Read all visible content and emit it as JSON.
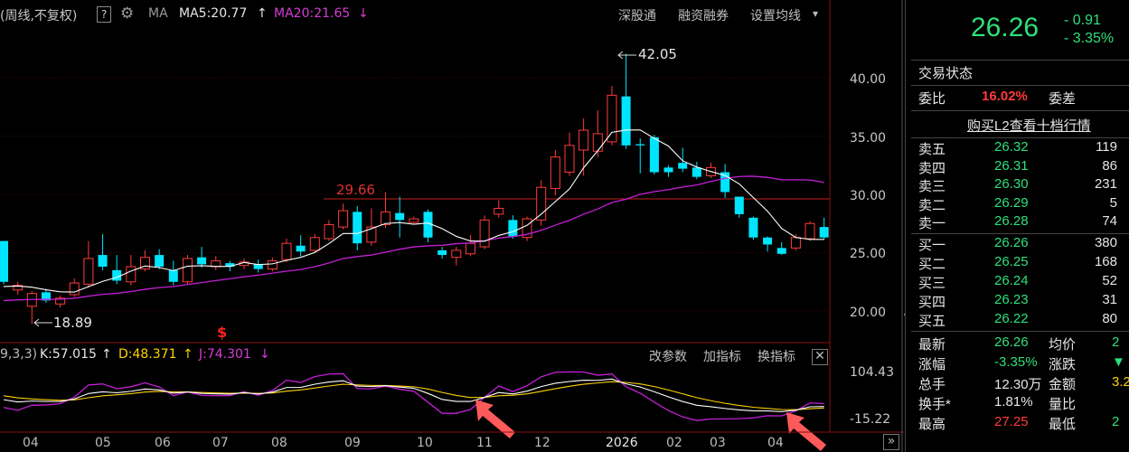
{
  "toolbar": {
    "period_label": "(周线,不复权)",
    "help_label": "?",
    "ma_label": "MA",
    "ma5_label": "MA5:20.77",
    "ma5_arrow": "↑",
    "ma20_label": "MA20:21.65",
    "ma20_arrow": "↓",
    "links": [
      "深股通",
      "融资融券",
      "设置均线"
    ],
    "dropdown_glyph": "▾"
  },
  "main_chart": {
    "y_ticks": [
      "40.00",
      "35.00",
      "30.00",
      "25.00",
      "20.00"
    ],
    "high_annotation": "42.05",
    "low_annotation": "18.89",
    "reference_line_label": "29.66",
    "marker_symbol": "$"
  },
  "kdj": {
    "params_label": "9,3,3)",
    "k_label": "K:57.015",
    "k_arrow": "↑",
    "d_label": "D:48.371",
    "d_arrow": "↑",
    "j_label": "J:74.301",
    "j_arrow": "↓",
    "buttons": [
      "改参数",
      "加指标",
      "换指标"
    ],
    "close_glyph": "✕",
    "y_top": "104.43",
    "y_bottom": "-15.22"
  },
  "x_axis": {
    "labels": [
      "04",
      "05",
      "06",
      "07",
      "08",
      "09",
      "10",
      "11",
      "12",
      "2026",
      "02",
      "03",
      "04"
    ],
    "scroll_glyph": "»"
  },
  "colors": {
    "up": "#ff3b3b",
    "down": "#00e5ff",
    "ma5": "#ffffff",
    "ma20": "#c31fd6",
    "k_line": "#ffffff",
    "d_line": "#ffd200",
    "j_line": "#c31fd6",
    "ref_line": "#c81e1e",
    "panel_green": "#2ee07a"
  },
  "chart_data": {
    "type": "candlestick",
    "period": "weekly",
    "series": [
      {
        "name": "MA5",
        "value": 20.77
      },
      {
        "name": "MA20",
        "value": 21.65
      }
    ],
    "high": 42.05,
    "low": 18.89,
    "reference": 29.66,
    "ylim": [
      17.5,
      45
    ],
    "candles": [
      [
        26.0,
        22.5,
        26.0,
        22.3
      ],
      [
        21.8,
        22.2,
        22.5,
        21.4
      ],
      [
        20.4,
        21.5,
        21.7,
        18.9
      ],
      [
        21.6,
        20.9,
        21.9,
        20.7
      ],
      [
        20.6,
        21.1,
        21.3,
        20.3
      ],
      [
        21.4,
        22.4,
        22.8,
        21.2
      ],
      [
        22.3,
        24.5,
        26.0,
        22.0
      ],
      [
        24.8,
        23.8,
        26.6,
        23.5
      ],
      [
        23.5,
        22.6,
        24.8,
        22.3
      ],
      [
        22.5,
        23.8,
        24.8,
        22.2
      ],
      [
        23.6,
        24.6,
        25.2,
        23.4
      ],
      [
        24.8,
        23.8,
        25.3,
        23.6
      ],
      [
        23.5,
        22.5,
        24.3,
        22.2
      ],
      [
        22.5,
        24.5,
        24.8,
        22.3
      ],
      [
        24.6,
        24.0,
        25.5,
        23.7
      ],
      [
        23.8,
        24.3,
        24.7,
        23.5
      ],
      [
        24.1,
        23.8,
        24.3,
        23.4
      ],
      [
        23.9,
        24.2,
        24.5,
        23.6
      ],
      [
        24.0,
        23.6,
        24.4,
        23.3
      ],
      [
        23.6,
        24.3,
        24.6,
        23.4
      ],
      [
        24.4,
        25.8,
        26.2,
        24.2
      ],
      [
        25.6,
        25.1,
        26.5,
        24.7
      ],
      [
        25.2,
        26.3,
        26.6,
        25.0
      ],
      [
        26.2,
        27.4,
        27.8,
        26.0
      ],
      [
        27.2,
        28.6,
        29.2,
        27.0
      ],
      [
        28.5,
        25.8,
        29.0,
        25.2
      ],
      [
        25.9,
        27.2,
        28.8,
        25.6
      ],
      [
        27.4,
        28.5,
        30.2,
        27.1
      ],
      [
        28.4,
        27.8,
        29.8,
        26.3
      ],
      [
        27.6,
        27.9,
        28.1,
        27.5
      ],
      [
        28.5,
        26.3,
        28.7,
        25.9
      ],
      [
        25.2,
        24.8,
        25.5,
        24.5
      ],
      [
        24.6,
        25.2,
        25.5,
        23.9
      ],
      [
        24.9,
        25.8,
        26.5,
        24.7
      ],
      [
        25.5,
        27.8,
        28.2,
        25.3
      ],
      [
        28.3,
        28.8,
        29.5,
        28.0
      ],
      [
        27.8,
        26.4,
        28.2,
        26.2
      ],
      [
        26.3,
        27.9,
        28.1,
        26.0
      ],
      [
        27.8,
        30.6,
        31.2,
        27.3
      ],
      [
        30.5,
        33.2,
        33.8,
        29.9
      ],
      [
        31.9,
        34.2,
        35.3,
        31.6
      ],
      [
        33.8,
        35.5,
        36.5,
        31.6
      ],
      [
        33.7,
        35.2,
        37.2,
        33.2
      ],
      [
        34.5,
        38.5,
        39.3,
        34.2
      ],
      [
        38.4,
        34.2,
        42.05,
        33.9
      ],
      [
        34.3,
        34.2,
        34.8,
        31.8
      ],
      [
        34.9,
        31.9,
        35.1,
        31.7
      ],
      [
        32.3,
        31.9,
        32.5,
        31.5
      ],
      [
        32.7,
        32.2,
        34.0,
        31.9
      ],
      [
        32.3,
        31.5,
        32.8,
        31.3
      ],
      [
        31.6,
        32.3,
        32.7,
        31.4
      ],
      [
        31.9,
        30.2,
        32.6,
        29.7
      ],
      [
        29.8,
        28.3,
        29.8,
        28.0
      ],
      [
        28.0,
        26.3,
        28.1,
        26.1
      ],
      [
        26.3,
        25.7,
        26.4,
        25.1
      ],
      [
        25.4,
        24.9,
        25.9,
        24.8
      ],
      [
        25.4,
        26.3,
        26.6,
        25.2
      ],
      [
        26.2,
        27.5,
        27.7,
        26.0
      ],
      [
        27.2,
        26.3,
        28.0,
        26.1
      ]
    ]
  },
  "panel": {
    "price": "26.26",
    "change": "- 0.91",
    "change_pct": "- 3.35%",
    "trade_status_label": "交易状态",
    "weibi_label": "委比",
    "weibi_value": "16.02%",
    "weicha_label": "委差",
    "l2_link": "购买L2查看十档行情",
    "asks": [
      {
        "label": "卖五",
        "price": "26.32",
        "vol": "119"
      },
      {
        "label": "卖四",
        "price": "26.31",
        "vol": "86"
      },
      {
        "label": "卖三",
        "price": "26.30",
        "vol": "231"
      },
      {
        "label": "卖二",
        "price": "26.29",
        "vol": "5"
      },
      {
        "label": "卖一",
        "price": "26.28",
        "vol": "74"
      }
    ],
    "bids": [
      {
        "label": "买一",
        "price": "26.26",
        "vol": "380"
      },
      {
        "label": "买二",
        "price": "26.25",
        "vol": "168"
      },
      {
        "label": "买三",
        "price": "26.24",
        "vol": "52"
      },
      {
        "label": "买四",
        "price": "26.23",
        "vol": "31"
      },
      {
        "label": "买五",
        "price": "26.22",
        "vol": "80"
      }
    ],
    "stats": [
      {
        "l1": "最新",
        "v1": "26.26",
        "l2": "均价",
        "v2": "2"
      },
      {
        "l1": "涨幅",
        "v1": "-3.35%",
        "l2": "涨跌",
        "v2": "▼"
      },
      {
        "l1": "总手",
        "v1": "12.30万",
        "l2": "金额",
        "v2": "3.2"
      },
      {
        "l1": "换手*",
        "v1": "1.81%",
        "l2": "量比",
        "v2": ""
      },
      {
        "l1": "最高",
        "v1": "27.25",
        "l2": "最低",
        "v2": "2"
      }
    ]
  }
}
